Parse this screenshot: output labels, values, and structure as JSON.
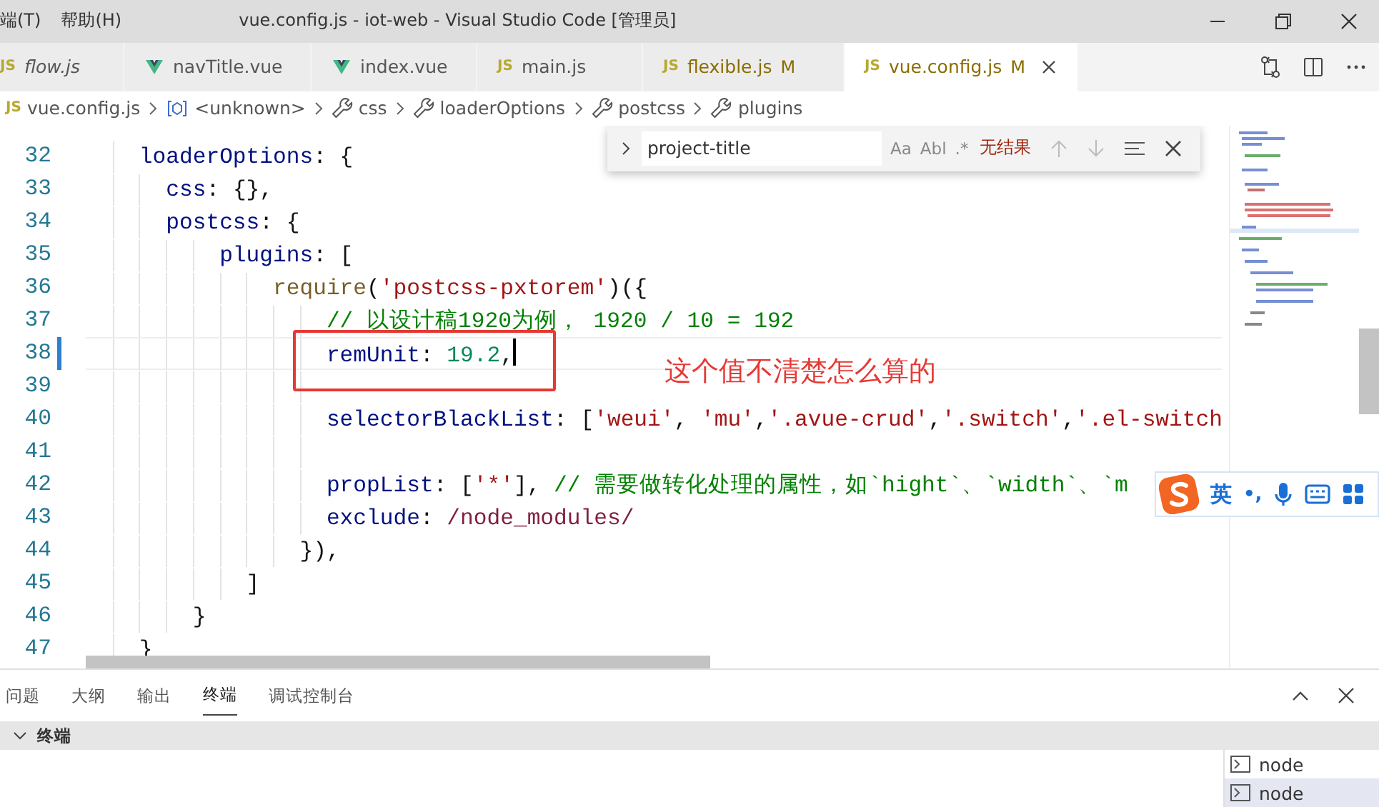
{
  "menu": [
    {
      "label": "端(T)"
    },
    {
      "label": "帮助(H)"
    }
  ],
  "window": {
    "title": "vue.config.js - iot-web - Visual Studio Code [管理员]"
  },
  "tabs": [
    {
      "label": "flow.js",
      "kind": "js",
      "icon_text": "JS",
      "preview": true,
      "modified": false,
      "selected": false
    },
    {
      "label": "navTitle.vue",
      "kind": "vue",
      "preview": false,
      "modified": false,
      "selected": false
    },
    {
      "label": "index.vue",
      "kind": "vue",
      "preview": false,
      "modified": false,
      "selected": false
    },
    {
      "label": "main.js",
      "kind": "js",
      "icon_text": "JS",
      "preview": false,
      "modified": false,
      "selected": false
    },
    {
      "label": "flexible.js",
      "kind": "js",
      "icon_text": "JS",
      "preview": false,
      "modified": true,
      "badge": "M",
      "selected": false
    },
    {
      "label": "vue.config.js",
      "kind": "js",
      "icon_text": "JS",
      "preview": false,
      "modified": true,
      "badge": "M",
      "selected": true
    }
  ],
  "breadcrumb": [
    {
      "label": "vue.config.js",
      "kind": "file",
      "icon_text": "JS"
    },
    {
      "label": "<unknown>",
      "kind": "module"
    },
    {
      "label": "css",
      "kind": "property"
    },
    {
      "label": "loaderOptions",
      "kind": "property"
    },
    {
      "label": "postcss",
      "kind": "property"
    },
    {
      "label": "plugins",
      "kind": "property"
    }
  ],
  "find": {
    "value": "project-title",
    "options": [
      "Aa",
      "Abl",
      ".*"
    ],
    "status": "无结果"
  },
  "lines": [
    {
      "number": "32",
      "current": false,
      "modified": false,
      "tokens": [
        {
          "kind": "key",
          "text": "    loaderOptions"
        },
        {
          "kind": "punct",
          "text": ": {"
        }
      ]
    },
    {
      "number": "33",
      "current": false,
      "modified": false,
      "tokens": [
        {
          "kind": "key",
          "text": "      css"
        },
        {
          "kind": "punct",
          "text": ": {},"
        }
      ]
    },
    {
      "number": "34",
      "current": false,
      "modified": false,
      "tokens": [
        {
          "kind": "key",
          "text": "      postcss"
        },
        {
          "kind": "punct",
          "text": ": {"
        }
      ]
    },
    {
      "number": "35",
      "current": false,
      "modified": false,
      "tokens": [
        {
          "kind": "key",
          "text": "          plugins"
        },
        {
          "kind": "punct",
          "text": ": ["
        }
      ]
    },
    {
      "number": "36",
      "current": false,
      "modified": false,
      "tokens": [
        {
          "kind": "func",
          "text": "              require"
        },
        {
          "kind": "punct",
          "text": "("
        },
        {
          "kind": "string",
          "text": "'postcss-pxtorem'"
        },
        {
          "kind": "punct",
          "text": ")({"
        }
      ]
    },
    {
      "number": "37",
      "current": false,
      "modified": false,
      "tokens": [
        {
          "kind": "comment",
          "text": "                  // 以设计稿1920为例， 1920 / 10 = 192"
        }
      ]
    },
    {
      "number": "38",
      "current": true,
      "modified": true,
      "tokens": [
        {
          "kind": "key",
          "text": "                  remUnit"
        },
        {
          "kind": "punct",
          "text": ": "
        },
        {
          "kind": "number",
          "text": "19.2"
        },
        {
          "kind": "punct",
          "text": ","
        }
      ]
    },
    {
      "number": "39",
      "current": false,
      "modified": false
    },
    {
      "number": "40",
      "current": false,
      "modified": false,
      "tokens": [
        {
          "kind": "key",
          "text": "                  selectorBlackList"
        },
        {
          "kind": "punct",
          "text": ": ["
        },
        {
          "kind": "string",
          "text": "'weui'"
        },
        {
          "kind": "punct",
          "text": ", "
        },
        {
          "kind": "string",
          "text": "'mu'"
        },
        {
          "kind": "punct",
          "text": ","
        },
        {
          "kind": "string",
          "text": "'.avue-crud'"
        },
        {
          "kind": "punct",
          "text": ","
        },
        {
          "kind": "string",
          "text": "'.switch'"
        },
        {
          "kind": "punct",
          "text": ","
        },
        {
          "kind": "string",
          "text": "'.el-switch"
        }
      ]
    },
    {
      "number": "41",
      "current": false,
      "modified": false
    },
    {
      "number": "42",
      "current": false,
      "modified": false,
      "tokens": [
        {
          "kind": "key",
          "text": "                  propList"
        },
        {
          "kind": "punct",
          "text": ": ["
        },
        {
          "kind": "string",
          "text": "'*'"
        },
        {
          "kind": "punct",
          "text": "], "
        },
        {
          "kind": "comment",
          "text": "// 需要做转化处理的属性，如`hight`、`width`、`m"
        }
      ]
    },
    {
      "number": "43",
      "current": false,
      "modified": false,
      "tokens": [
        {
          "kind": "key",
          "text": "                  exclude"
        },
        {
          "kind": "punct",
          "text": ": "
        },
        {
          "kind": "regex",
          "text": "/node_modules/"
        }
      ]
    },
    {
      "number": "44",
      "current": false,
      "modified": false,
      "tokens": [
        {
          "kind": "punct",
          "text": "                }),"
        }
      ]
    },
    {
      "number": "45",
      "current": false,
      "modified": false,
      "tokens": [
        {
          "kind": "punct",
          "text": "            ]"
        }
      ]
    },
    {
      "number": "46",
      "current": false,
      "modified": false,
      "tokens": [
        {
          "kind": "punct",
          "text": "        }"
        }
      ]
    },
    {
      "number": "47",
      "current": false,
      "modified": false,
      "tokens": [
        {
          "kind": "punct",
          "text": "    }"
        }
      ]
    }
  ],
  "annotation": {
    "text": "这个值不清楚怎么算的"
  },
  "ime_toolbar": {
    "mode": "英",
    "punctuation": "•,"
  },
  "panel": {
    "tabs": [
      {
        "label": "问题",
        "selected": false
      },
      {
        "label": "大纲",
        "selected": false
      },
      {
        "label": "输出",
        "selected": false
      },
      {
        "label": "终端",
        "selected": true
      },
      {
        "label": "调试控制台",
        "selected": false
      }
    ],
    "section": {
      "title": "终端",
      "expanded": true
    },
    "terminals": [
      {
        "label": "node",
        "selected": false
      },
      {
        "label": "node",
        "selected": true
      }
    ]
  }
}
